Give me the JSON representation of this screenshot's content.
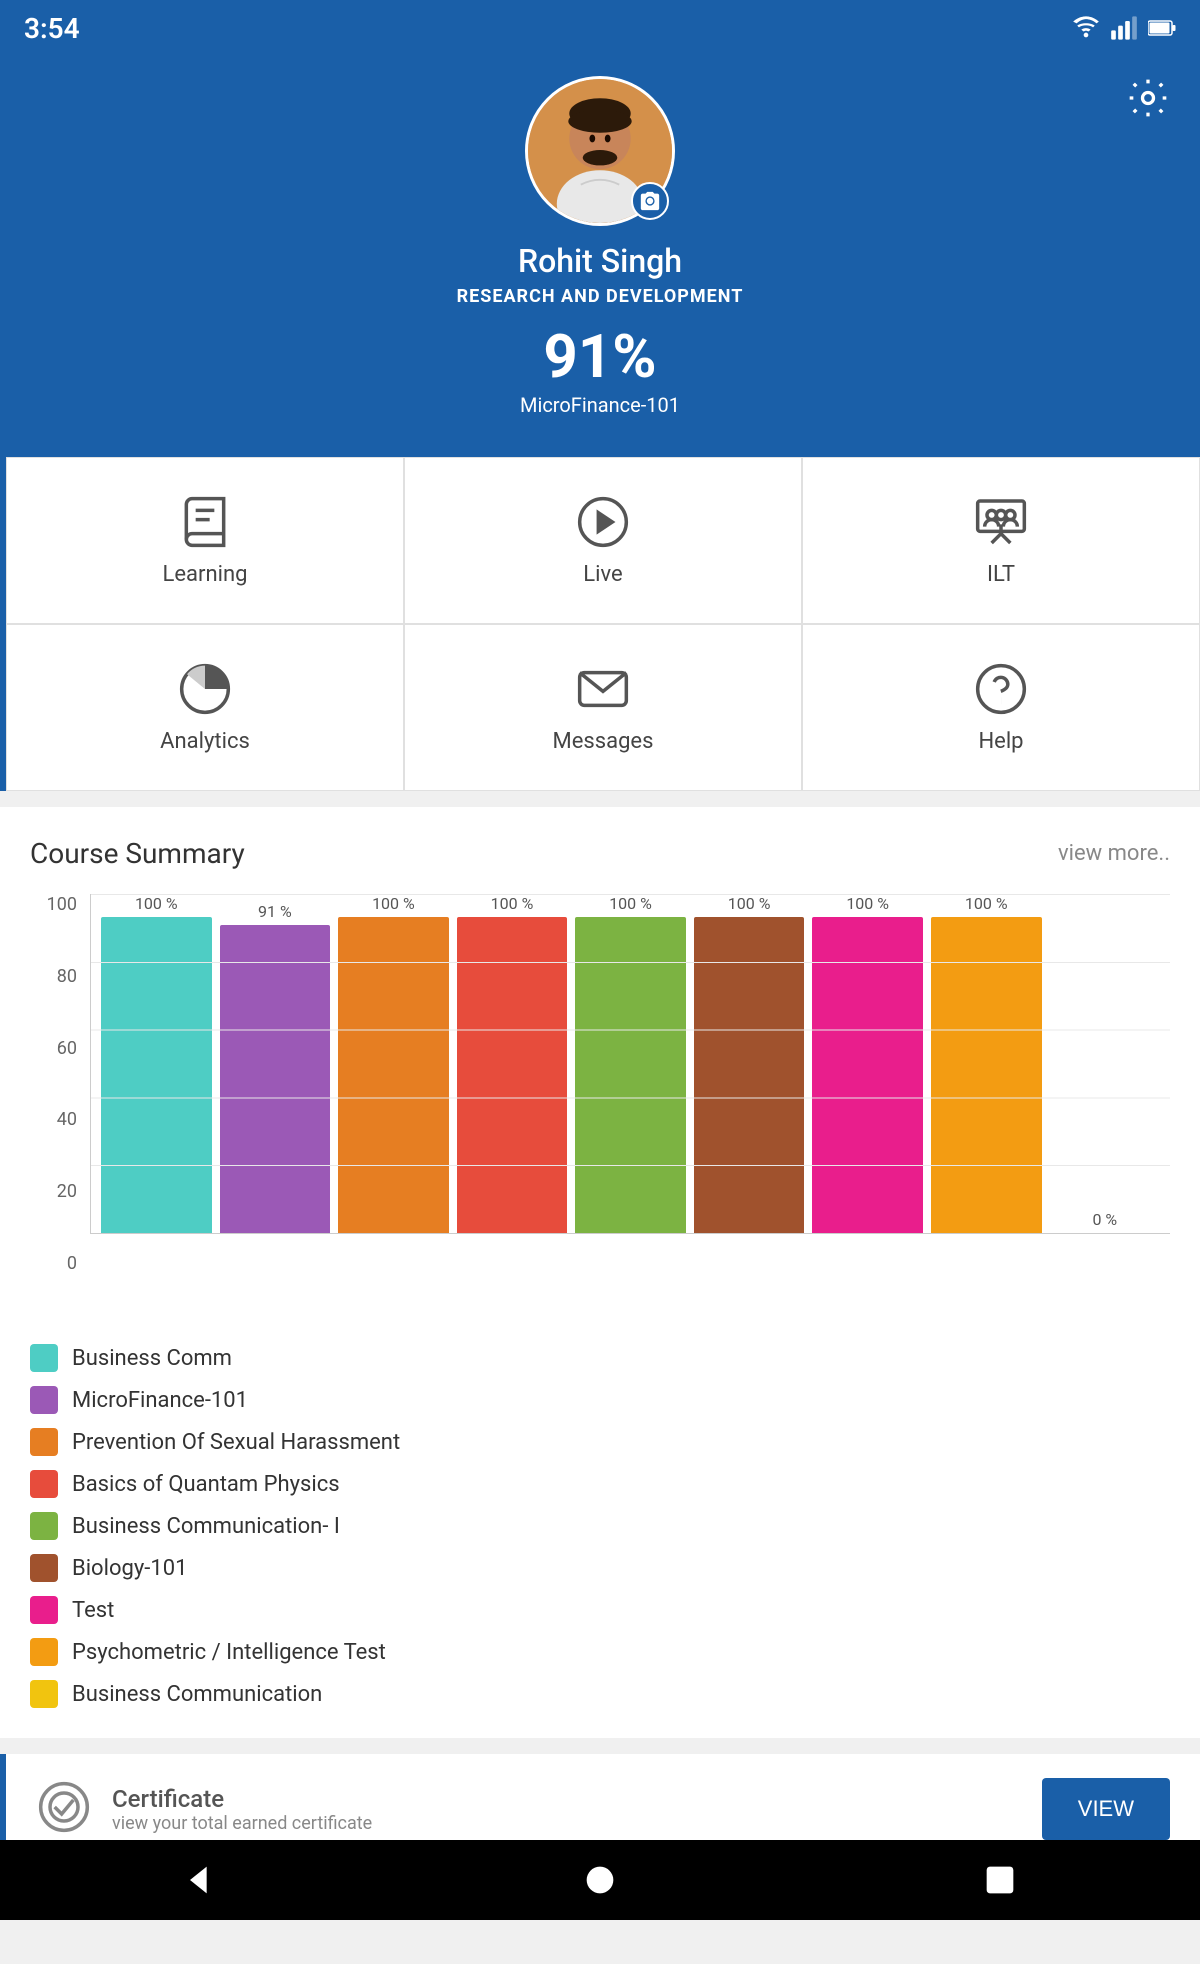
{
  "statusBar": {
    "time": "3:54"
  },
  "settings": {
    "icon": "gear-icon"
  },
  "profile": {
    "name": "Rohit Singh",
    "department": "RESEARCH AND DEVELOPMENT",
    "score": "91%",
    "course": "MicroFinance-101"
  },
  "nav": {
    "items": [
      {
        "id": "learning",
        "label": "Learning"
      },
      {
        "id": "live",
        "label": "Live"
      },
      {
        "id": "ilt",
        "label": "ILT"
      },
      {
        "id": "analytics",
        "label": "Analytics"
      },
      {
        "id": "messages",
        "label": "Messages"
      },
      {
        "id": "help",
        "label": "Help"
      }
    ]
  },
  "courseSummary": {
    "title": "Course Summary",
    "viewMore": "view more..",
    "bars": [
      {
        "label": "Business Comm",
        "value": 100,
        "displayValue": "100 %",
        "color": "#4ecdc4"
      },
      {
        "label": "MicroFinance-101",
        "value": 91,
        "displayValue": "91 %",
        "color": "#9b59b6"
      },
      {
        "label": "Prevention Of Sexual Harassment",
        "value": 100,
        "displayValue": "100 %",
        "color": "#e67e22"
      },
      {
        "label": "Basics of Quantam Physics",
        "value": 100,
        "displayValue": "100 %",
        "color": "#e74c3c"
      },
      {
        "label": "Business Communication- I",
        "value": 100,
        "displayValue": "100 %",
        "color": "#7cb342"
      },
      {
        "label": "Biology-101",
        "value": 100,
        "displayValue": "100 %",
        "color": "#a0522d"
      },
      {
        "label": "Test",
        "value": 100,
        "displayValue": "100 %",
        "color": "#e91e8c"
      },
      {
        "label": "Psychometric / Intelligence Test",
        "value": 100,
        "displayValue": "100 %",
        "color": "#f39c12"
      },
      {
        "label": "Business Communication",
        "value": 0,
        "displayValue": "0 %",
        "color": "#f1c40f"
      }
    ],
    "yAxis": [
      "0",
      "20",
      "40",
      "60",
      "80",
      "100"
    ]
  },
  "certificate": {
    "title": "Certificate",
    "subtitle": "view your total earned certificate",
    "buttonLabel": "VIEW"
  },
  "bottomNav": {
    "back": "◀",
    "home": "●",
    "recent": "■"
  }
}
